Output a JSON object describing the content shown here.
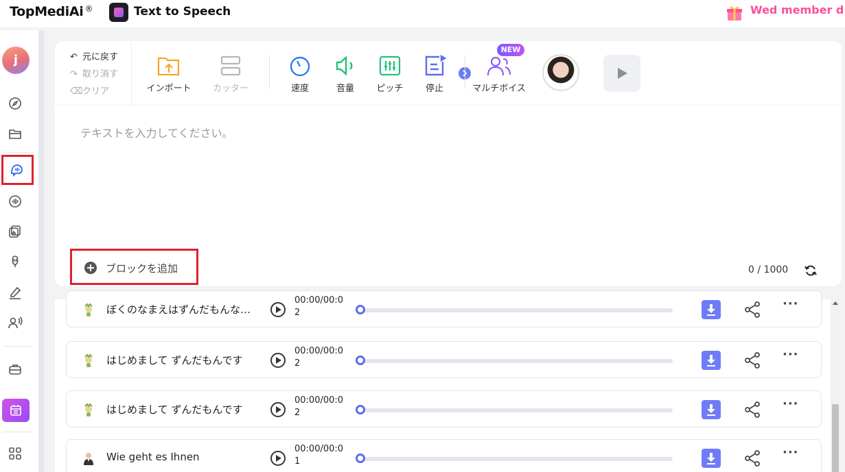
{
  "header": {
    "brand": "TopMediAi",
    "brand_mark": "®",
    "app_title": "Text to Speech",
    "promo_text": "Wed member d"
  },
  "sidebar": {
    "avatar_letter": "j",
    "items": [
      {
        "icon": "compass-icon"
      },
      {
        "icon": "folder-icon"
      },
      {
        "icon": "text-to-speech-icon",
        "active": true
      },
      {
        "icon": "voice-wave-icon"
      },
      {
        "icon": "cards-icon"
      },
      {
        "icon": "microphone-icon"
      },
      {
        "icon": "pen-icon"
      },
      {
        "icon": "speaker-person-icon"
      },
      {
        "icon": "toolbox-icon"
      },
      {
        "icon": "calendar-icon"
      },
      {
        "icon": "apps-grid-icon"
      }
    ]
  },
  "toolbar": {
    "undo": "元に戻す",
    "redo": "取り消す",
    "clear": "クリア",
    "import": "インポート",
    "cutter": "カッター",
    "speed": "速度",
    "volume": "音量",
    "pitch": "ピッチ",
    "pause": "停止",
    "multivoice": "マルチボイス",
    "new_badge": "NEW"
  },
  "editor": {
    "placeholder": "テキストを入力してください。",
    "add_block": "ブロックを追加",
    "char_count": "0",
    "char_separator": " / ",
    "char_limit": "1000"
  },
  "audio_list": [
    {
      "text": "ぼくのなまえはずんだもんな…",
      "time": "00:00/00:02",
      "progress": 0
    },
    {
      "text": "はじめまして ずんだもんです",
      "time": "00:00/00:02",
      "progress": 0
    },
    {
      "text": "はじめまして ずんだもんです",
      "time": "00:00/00:02",
      "progress": 0
    },
    {
      "text": "Wie geht es Ihnen",
      "time": "00:00/00:01",
      "progress": 0
    }
  ],
  "colors": {
    "accent": "#6f7cf7",
    "highlight_box": "#e0202e",
    "promo": "#ff4f9a",
    "tool_orange": "#f5a623",
    "tool_blue": "#2f7bf5",
    "tool_green": "#22c27a",
    "tool_indigo": "#5b6cf0",
    "tool_purple": "#8b5cf6"
  }
}
